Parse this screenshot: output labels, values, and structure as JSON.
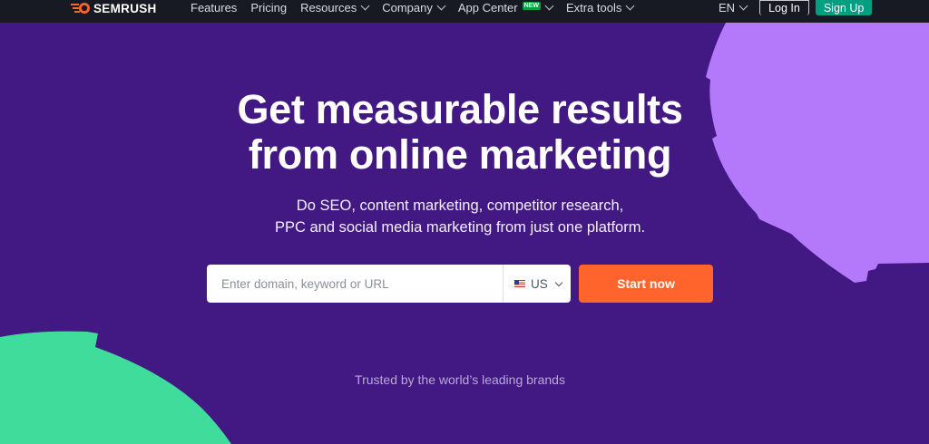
{
  "header": {
    "logo_text": "SEMRUSH",
    "nav": [
      {
        "label": "Features",
        "dropdown": false
      },
      {
        "label": "Pricing",
        "dropdown": false
      },
      {
        "label": "Resources",
        "dropdown": true
      },
      {
        "label": "Company",
        "dropdown": true
      },
      {
        "label": "App Center",
        "dropdown": true,
        "badge": "NEW"
      },
      {
        "label": "Extra tools",
        "dropdown": true
      }
    ],
    "language": "EN",
    "login_label": "Log In",
    "signup_label": "Sign Up"
  },
  "hero": {
    "title_line1": "Get measurable results",
    "title_line2": "from online marketing",
    "subtitle_line1": "Do SEO, content marketing, competitor research,",
    "subtitle_line2": "PPC and social media marketing from just one platform."
  },
  "search": {
    "placeholder": "Enter domain, keyword or URL",
    "value": "",
    "database": "US",
    "database_icon": "us-flag-icon",
    "button_label": "Start now"
  },
  "trusted_text": "Trusted by the world’s leading brands",
  "colors": {
    "background": "#421983",
    "topbar": "#171a22",
    "accent_orange": "#ff642d",
    "accent_green": "#009f81",
    "deco_lilac": "#b479fb",
    "deco_mint": "#3fdc9c"
  }
}
